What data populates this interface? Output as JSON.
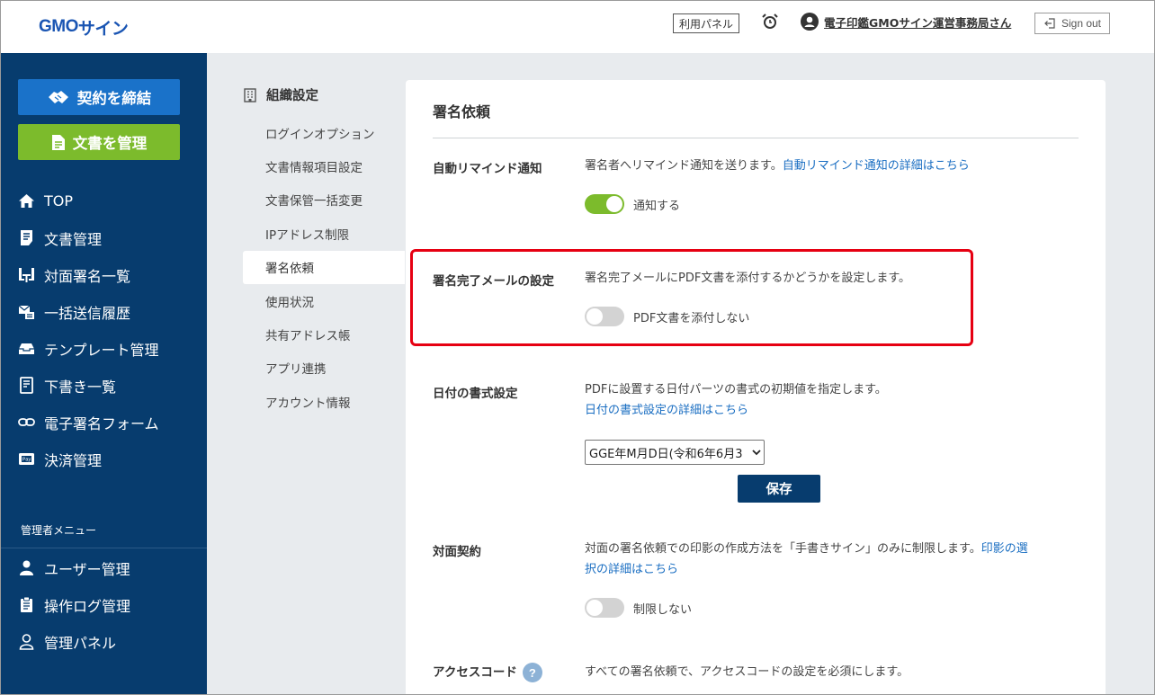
{
  "header": {
    "logo_gmo": "GMO",
    "logo_sign": "サイン",
    "panel_button": "利用パネル",
    "user_name": "電子印鑑GMOサイン運営事務局さん",
    "signout": "Sign out"
  },
  "sidebar": {
    "contract_button": "契約を締結",
    "docs_button": "文書を管理",
    "items": [
      {
        "label": "TOP",
        "icon": "home-icon"
      },
      {
        "label": "文書管理",
        "icon": "document-icon"
      },
      {
        "label": "対面署名一覧",
        "icon": "meeting-icon"
      },
      {
        "label": "一括送信履歴",
        "icon": "bulk-send-icon"
      },
      {
        "label": "テンプレート管理",
        "icon": "template-icon"
      },
      {
        "label": "下書き一覧",
        "icon": "draft-icon"
      },
      {
        "label": "電子署名フォーム",
        "icon": "link-icon"
      },
      {
        "label": "決済管理",
        "icon": "pay-icon"
      }
    ],
    "admin_title": "管理者メニュー",
    "admin_items": [
      {
        "label": "ユーザー管理",
        "icon": "user-icon"
      },
      {
        "label": "操作ログ管理",
        "icon": "log-icon"
      },
      {
        "label": "管理パネル",
        "icon": "admin-panel-icon"
      }
    ]
  },
  "submenu": {
    "title": "組織設定",
    "items": [
      "ログインオプション",
      "文書情報項目設定",
      "文書保管一括変更",
      "IPアドレス制限",
      "署名依頼",
      "使用状況",
      "共有アドレス帳",
      "アプリ連携",
      "アカウント情報"
    ],
    "active_index": 4
  },
  "panel": {
    "title": "署名依頼",
    "auto_remind": {
      "label": "自動リマインド通知",
      "desc": "署名者へリマインド通知を送ります。",
      "link": "自動リマインド通知の詳細はこちら",
      "toggle_label": "通知する",
      "toggle_on": true
    },
    "complete_mail": {
      "label": "署名完了メールの設定",
      "desc": "署名完了メールにPDF文書を添付するかどうかを設定します。",
      "toggle_label": "PDF文書を添付しない",
      "toggle_on": false
    },
    "date_format": {
      "label": "日付の書式設定",
      "desc": "PDFに設置する日付パーツの書式の初期値を指定します。",
      "link": "日付の書式設定の詳細はこちら",
      "select_value": "GGE年M月D日(令和6年6月3",
      "save_label": "保存"
    },
    "face_to_face": {
      "label": "対面契約",
      "desc": "対面の署名依頼での印影の作成方法を「手書きサイン」のみに制限します。",
      "link_line1": "印影の選",
      "link_line2": "択の詳細はこちら",
      "toggle_label": "制限しない",
      "toggle_on": false
    },
    "access_code": {
      "label": "アクセスコード",
      "help": "?",
      "desc": "すべての署名依頼で、アクセスコードの設定を必須にします。"
    }
  },
  "colors": {
    "sidebar": "#073c6e",
    "contract_button": "#1a72c9",
    "docs_button": "#7cbb2c",
    "toggle_on": "#7cbb2c",
    "highlight": "#e60012",
    "link": "#1a6ec2"
  }
}
